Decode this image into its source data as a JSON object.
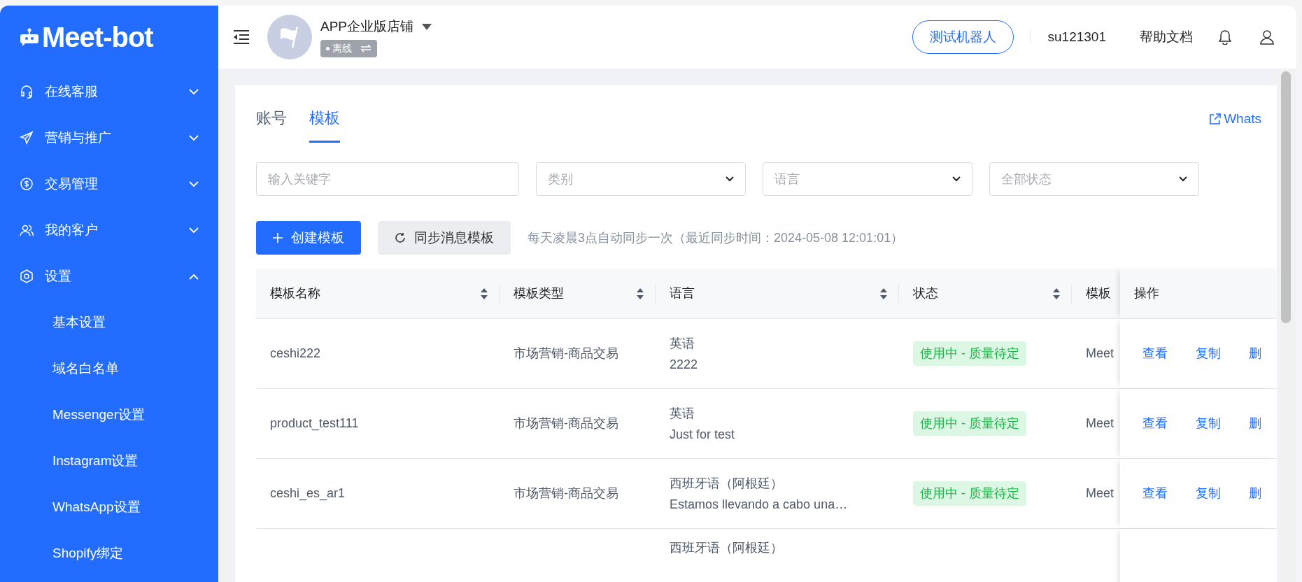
{
  "sidebar": {
    "logo": "Meet-bot",
    "items": [
      {
        "label": "在线客服",
        "expanded": false
      },
      {
        "label": "营销与推广",
        "expanded": false
      },
      {
        "label": "交易管理",
        "expanded": false
      },
      {
        "label": "我的客户",
        "expanded": false
      },
      {
        "label": "设置",
        "expanded": true,
        "children": [
          {
            "label": "基本设置"
          },
          {
            "label": "域名白名单"
          },
          {
            "label": "Messenger设置"
          },
          {
            "label": "Instagram设置"
          },
          {
            "label": "WhatsApp设置"
          },
          {
            "label": "Shopify绑定"
          }
        ]
      }
    ]
  },
  "header": {
    "store_name": "APP企业版店铺",
    "store_status": "离线",
    "test_button": "测试机器人",
    "username": "su121301",
    "help": "帮助文档"
  },
  "tabs": [
    {
      "label": "账号",
      "selected": false
    },
    {
      "label": "模板",
      "selected": true
    }
  ],
  "external_link": "Whats",
  "filters": {
    "keyword_placeholder": "输入关键字",
    "selects": [
      {
        "placeholder": "类别"
      },
      {
        "placeholder": "语言"
      },
      {
        "placeholder": "全部状态"
      }
    ]
  },
  "actions": {
    "create": "创建模板",
    "sync": "同步消息模板",
    "sync_note": "每天凌晨3点自动同步一次（最近同步时间：2024-05-08 12:01:01）"
  },
  "table": {
    "columns": [
      {
        "label": "模板名称",
        "sortable": true
      },
      {
        "label": "模板类型",
        "sortable": true
      },
      {
        "label": "语言",
        "sortable": true
      },
      {
        "label": "状态",
        "sortable": true
      },
      {
        "label": "模板"
      }
    ],
    "action_column": "操作",
    "rows": [
      {
        "name": "ceshi222",
        "type": "市场营销-商品交易",
        "language": "英语",
        "body": "2222",
        "status": "使用中 - 质量待定",
        "column_5": "Meet",
        "actions": [
          "查看",
          "复制",
          "删"
        ]
      },
      {
        "name": "product_test111",
        "type": "市场营销-商品交易",
        "language": "英语",
        "body": "Just for test",
        "status": "使用中 - 质量待定",
        "column_5": "Meet",
        "actions": [
          "查看",
          "复制",
          "删"
        ]
      },
      {
        "name": "ceshi_es_ar1",
        "type": "市场营销-商品交易",
        "language": "西班牙语（阿根廷）",
        "body": "Estamos llevando a cabo una…",
        "status": "使用中 - 质量待定",
        "column_5": "Meet",
        "actions": [
          "查看",
          "复制",
          "删"
        ]
      },
      {
        "language": "西班牙语（阿根廷）"
      }
    ]
  }
}
